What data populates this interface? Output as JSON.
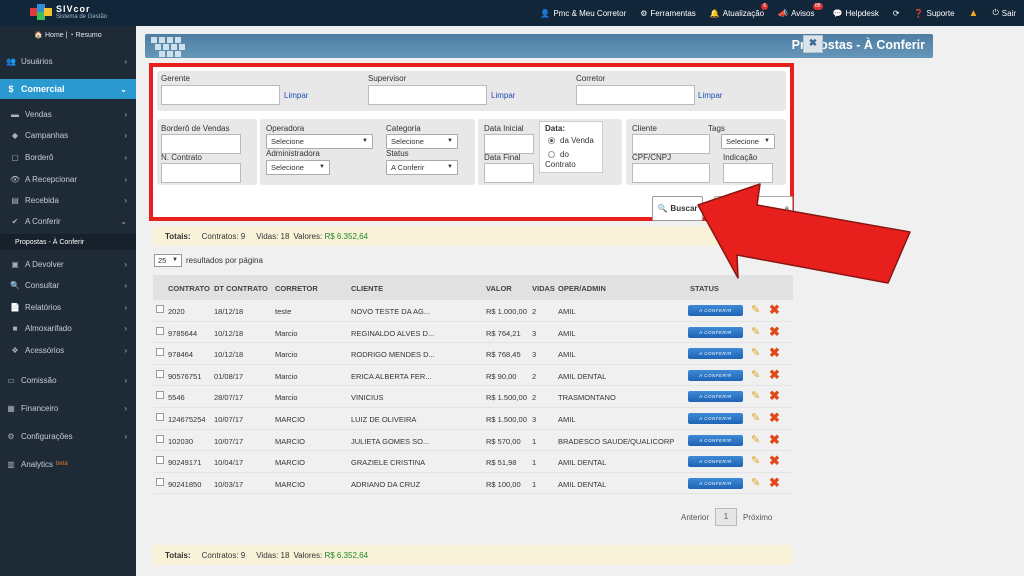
{
  "app": {
    "brand": "SIVcor",
    "subtitle": "Sistema de Gestão"
  },
  "topnav": [
    {
      "label": "Pmc & Meu Corretor",
      "icon": "user-icon"
    },
    {
      "label": "Ferramentas",
      "icon": "tools-icon"
    },
    {
      "label": "Atualização",
      "icon": "bell-icon",
      "badge": "6"
    },
    {
      "label": "Avisos",
      "icon": "megaphone-icon",
      "badge": "88"
    },
    {
      "label": "Helpdesk",
      "icon": "chat-icon"
    },
    {
      "label": "",
      "icon": "refresh-icon"
    },
    {
      "label": "Suporte",
      "icon": "question-icon"
    },
    {
      "label": "",
      "icon": "warning-icon"
    },
    {
      "label": "Sair",
      "icon": "power-icon"
    }
  ],
  "sidebar": {
    "home": "Home",
    "resumo": "Resumo",
    "usuarios": "Usuários",
    "comercial": "Comercial",
    "items": [
      "Vendas",
      "Campanhas",
      "Borderô",
      "A Recepcionar",
      "Recebida",
      "A Conferir"
    ],
    "active": "Propostas - À Conferir",
    "items2": [
      "A Devolver",
      "Consultar",
      "Relatórios",
      "Almoxarifado",
      "Acessórios"
    ],
    "sections": [
      "Comissão",
      "Financeiro",
      "Configurações",
      "Analytics"
    ],
    "beta": "beta"
  },
  "page": {
    "title": "Propostas - À Conferir",
    "close": "✖"
  },
  "filters": {
    "gerente": "Gerente",
    "supervisor": "Supervisor",
    "corretor": "Corretor",
    "limpar": "Limpar",
    "bordero": "Borderô de Vendas",
    "contrato": "N. Contrato",
    "operadora": "Operadora",
    "administradora": "Administradora",
    "categoria": "Categoria",
    "status": "Status",
    "selecione": "Selecione",
    "status_value": "A Conferir",
    "data_inicial": "Data Inicial",
    "data_final": "Data Final",
    "data": "Data:",
    "radio_venda": "da Venda",
    "radio_contrato_1": "do",
    "radio_contrato_2": "Contrato",
    "cliente": "Cliente",
    "tags": "Tags",
    "cpf": "CPF/CNPJ",
    "indicacao": "Indicação",
    "buscar": "Buscar",
    "second_button": "a"
  },
  "totals": {
    "label": "Totais:",
    "contratos": "Contratos: 9",
    "vidas": "Vidas: 18",
    "valores_label": "Valores:",
    "valores": "R$ 6.352,64"
  },
  "perpage": {
    "value": "25",
    "label": "resultados por página"
  },
  "table": {
    "headers": [
      "CONTRATO",
      "DT CONTRATO",
      "CORRETOR",
      "CLIENTE",
      "VALOR",
      "VIDAS",
      "OPER/ADMIN",
      "STATUS"
    ],
    "status_label": "A CONFERIR",
    "rows": [
      [
        "2020",
        "18/12/18",
        "teste",
        "NOVO TESTE DA AG...",
        "R$ 1.000,00",
        "2",
        "AMIL"
      ],
      [
        "9785644",
        "10/12/18",
        "Marcio",
        "REGINALDO ALVES D...",
        "R$ 764,21",
        "3",
        "AMIL"
      ],
      [
        "978464",
        "10/12/18",
        "Marcio",
        "RODRIGO MENDES D...",
        "R$ 768,45",
        "3",
        "AMIL"
      ],
      [
        "90576751",
        "01/08/17",
        "Marcio",
        "ERICA ALBERTA FER...",
        "R$ 90,00",
        "2",
        "AMIL DENTAL"
      ],
      [
        "5546",
        "28/07/17",
        "Marcio",
        "VINICIUS",
        "R$ 1.500,00",
        "2",
        "TRASMONTANO"
      ],
      [
        "124675254",
        "10/07/17",
        "MARCIO",
        "LUIZ DE OLIVEIRA",
        "R$ 1.500,00",
        "3",
        "AMIL"
      ],
      [
        "102030",
        "10/07/17",
        "MARCIO",
        "JULIETA GOMES SO...",
        "R$ 570,00",
        "1",
        "BRADESCO SAUDE/QUALICORP"
      ],
      [
        "90249171",
        "10/04/17",
        "MARCIO",
        "GRAZIELE CRISTINA",
        "R$ 51,98",
        "1",
        "AMIL DENTAL"
      ],
      [
        "90241850",
        "10/03/17",
        "MARCIO",
        "ADRIANO DA CRUZ",
        "R$ 100,00",
        "1",
        "AMIL DENTAL"
      ]
    ]
  },
  "pager": {
    "prev": "Anterior",
    "page": "1",
    "next": "Próximo"
  },
  "colors": {
    "topbar": "#12263a",
    "sidebar": "#1e2b37",
    "accent": "#2a9ad1",
    "highlight": "#e8201d"
  }
}
